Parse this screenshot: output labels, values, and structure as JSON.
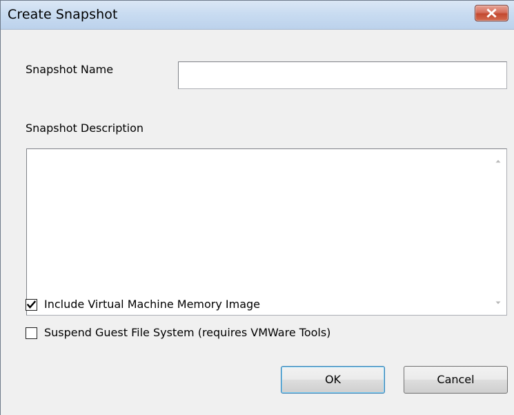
{
  "window": {
    "title": "Create Snapshot",
    "close_icon": "close-icon"
  },
  "form": {
    "snapshot_name_label": "Snapshot Name",
    "snapshot_name_value": "",
    "snapshot_description_label": "Snapshot Description",
    "snapshot_description_value": ""
  },
  "options": {
    "include_memory": {
      "label": "Include Virtual Machine Memory Image",
      "checked": true
    },
    "suspend_fs": {
      "label": "Suspend Guest File System (requires VMWare Tools)",
      "checked": false
    }
  },
  "buttons": {
    "ok_label": "OK",
    "cancel_label": "Cancel"
  },
  "colors": {
    "title_bar": "#c9dcf1",
    "close_button": "#c34a31",
    "dialog_background": "#f0f0f0",
    "default_button_border": "#3c7fb1"
  }
}
